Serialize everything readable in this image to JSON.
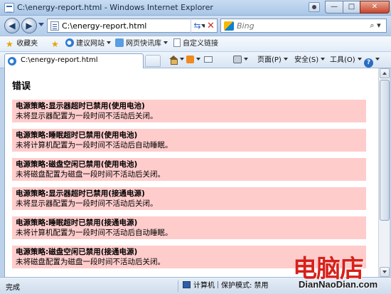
{
  "window": {
    "title": "C:\\energy-report.html - Windows Internet Explorer",
    "min_glyph": "—",
    "max_glyph": "□",
    "close_glyph": "✕"
  },
  "address": {
    "back_glyph": "◀",
    "forward_glyph": "▶",
    "url": "C:\\energy-report.html",
    "refresh_glyph": "⇆",
    "stop_glyph": "✕",
    "search_placeholder": "Bing",
    "search_go_glyph": "⌕ ▾"
  },
  "favorites": {
    "favorites_label": "收藏夹",
    "suggested_sites": "建议网站",
    "web_slice_gallery": "网页快讯库",
    "custom_links": "自定义链接"
  },
  "tab": {
    "label": "C:\\energy-report.html"
  },
  "commands": {
    "page_menu": "页面(P)",
    "safety_menu": "安全(S)",
    "tools_menu": "工具(O)",
    "help_glyph": "?"
  },
  "report": {
    "heading": "错误",
    "errors": [
      {
        "title": "电源策略:显示器超时已禁用(使用电池)",
        "desc": "未将显示器配置为一段时间不活动后关闭。"
      },
      {
        "title": "电源策略:睡眠超时已禁用(使用电池)",
        "desc": "未将计算机配置为一段时间不活动后自动睡眠。"
      },
      {
        "title": "电源策略:磁盘空闲已禁用(使用电池)",
        "desc": "未将磁盘配置为磁盘一段时间不活动后关闭。"
      },
      {
        "title": "电源策略:显示器超时已禁用(接通电源)",
        "desc": "未将显示器配置为一段时间不活动后关闭。"
      },
      {
        "title": "电源策略:睡眠超时已禁用(接通电源)",
        "desc": "未将计算机配置为一段时间不活动后自动睡眠。"
      },
      {
        "title": "电源策略:磁盘空闲已禁用(接通电源)",
        "desc": "未将磁盘配置为磁盘一段时间不活动后关闭。"
      }
    ]
  },
  "status": {
    "text": "完成",
    "zone": "计算机",
    "protected_mode": "保护模式: 禁用"
  },
  "watermark": {
    "logo": "电脑店",
    "url": "DianNaoDian.com"
  },
  "colors": {
    "error_background": "#ffcccc",
    "watermark_red": "#d7201a"
  }
}
